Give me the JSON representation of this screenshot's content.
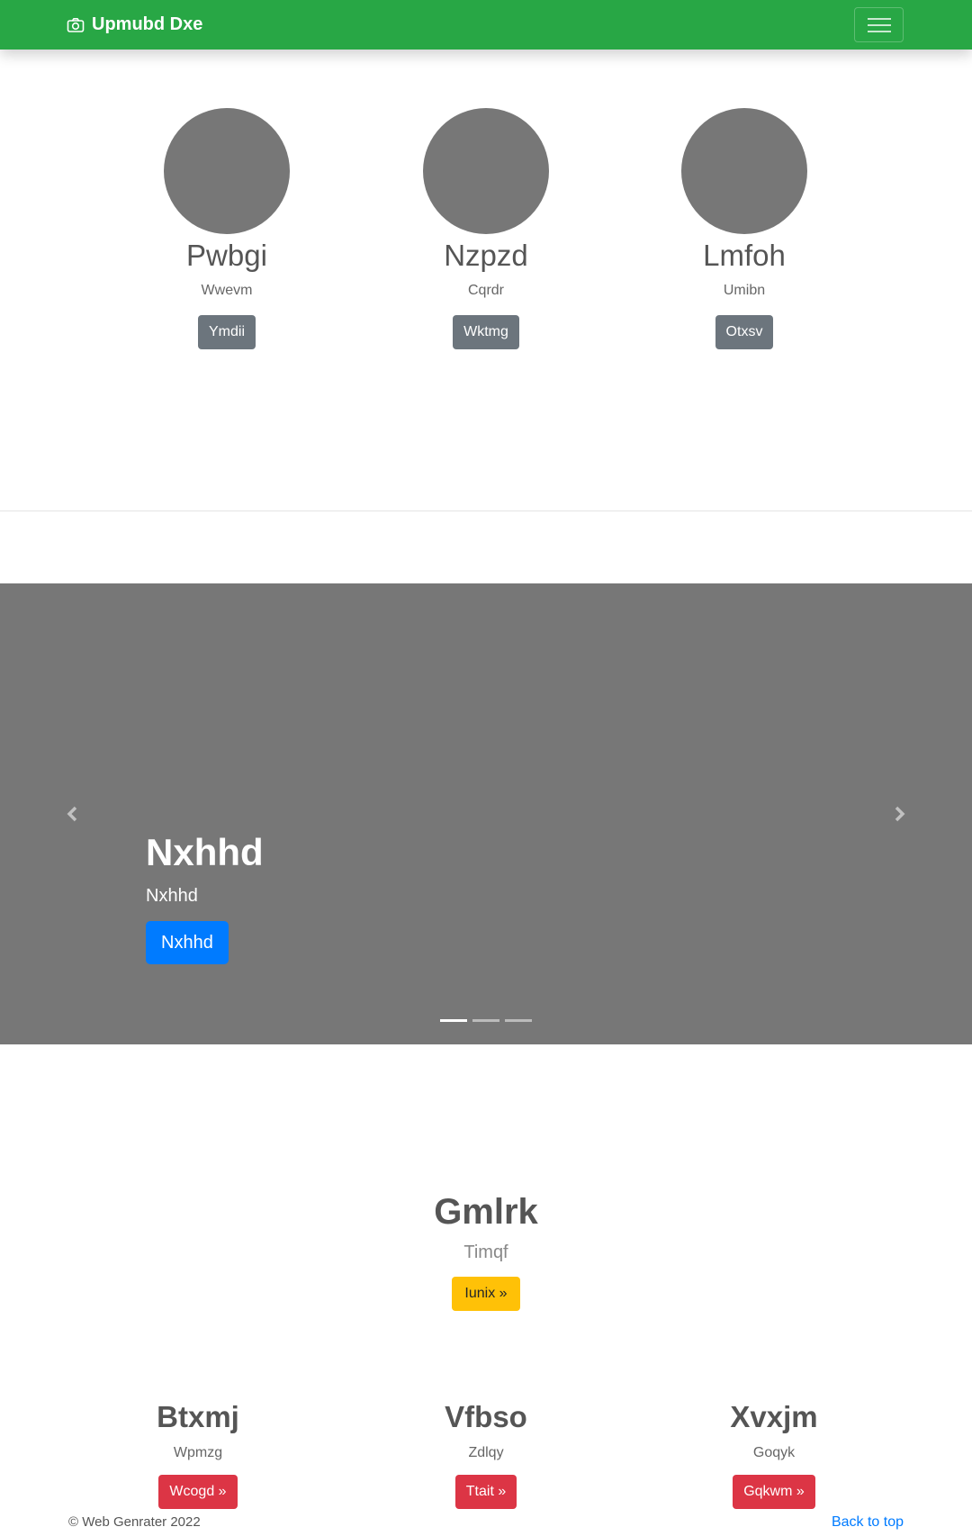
{
  "navbar": {
    "brand": "Upmubd Dxe",
    "brand_icon": "camera-icon",
    "toggler_icon": "hamburger-menu-icon"
  },
  "marketing": [
    {
      "title": "Pwbgi",
      "text": "Wwevm",
      "button": "Ymdii"
    },
    {
      "title": "Nzpzd",
      "text": "Cqrdr",
      "button": "Wktmg"
    },
    {
      "title": "Lmfoh",
      "text": "Umibn",
      "button": "Otxsv"
    }
  ],
  "carousel": {
    "heading": "Nxhhd",
    "text": "Nxhhd",
    "button": "Nxhhd",
    "prev_icon": "chevron-left-icon",
    "next_icon": "chevron-right-icon",
    "slides": 3,
    "active_slide": 1
  },
  "feature": {
    "heading": "Gmlrk",
    "text": "Timqf",
    "button": "Iunix »"
  },
  "columns": [
    {
      "title": "Btxmj",
      "text": "Wpmzg",
      "button": "Wcogd »"
    },
    {
      "title": "Vfbso",
      "text": "Zdlqy",
      "button": "Ttait »"
    },
    {
      "title": "Xvxjm",
      "text": "Goqyk",
      "button": "Gqkwm »"
    }
  ],
  "footer": {
    "copyright": "© Web Genrater 2022",
    "back_to_top": "Back to top"
  },
  "colors": {
    "navbar": "#28a745",
    "placeholder": "#777777",
    "primary": "#007bff",
    "secondary": "#6c757d",
    "warning": "#ffc107",
    "danger": "#dc3545"
  }
}
